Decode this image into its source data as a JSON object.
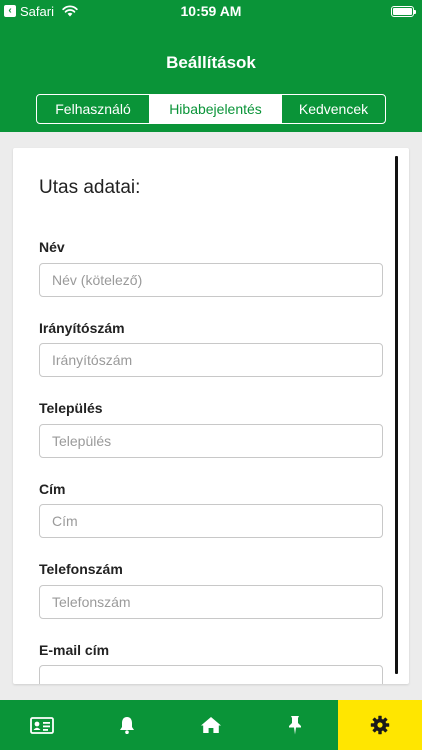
{
  "status_bar": {
    "back_app": "Safari",
    "time": "10:59 AM"
  },
  "header": {
    "title": "Beállítások",
    "tabs": [
      {
        "label": "Felhasználó",
        "active": false
      },
      {
        "label": "Hibabejelentés",
        "active": true
      },
      {
        "label": "Kedvencek",
        "active": false
      }
    ]
  },
  "form": {
    "section_title": "Utas adatai:",
    "fields": [
      {
        "label": "Név",
        "placeholder": "Név (kötelező)",
        "value": ""
      },
      {
        "label": "Irányítószám",
        "placeholder": "Irányítószám",
        "value": ""
      },
      {
        "label": "Település",
        "placeholder": "Település",
        "value": ""
      },
      {
        "label": "Cím",
        "placeholder": "Cím",
        "value": ""
      },
      {
        "label": "Telefonszám",
        "placeholder": "Telefonszám",
        "value": ""
      },
      {
        "label": "E-mail cím",
        "placeholder": "",
        "value": ""
      }
    ]
  },
  "tab_bar": {
    "items": [
      {
        "icon": "id-card-icon",
        "active": false
      },
      {
        "icon": "bell-icon",
        "active": false
      },
      {
        "icon": "home-icon",
        "active": false
      },
      {
        "icon": "pin-icon",
        "active": false
      },
      {
        "icon": "gear-icon",
        "active": true
      }
    ]
  },
  "colors": {
    "brand_green": "#0a9438",
    "active_tab_yellow": "#ffe600",
    "background": "#ececec"
  }
}
